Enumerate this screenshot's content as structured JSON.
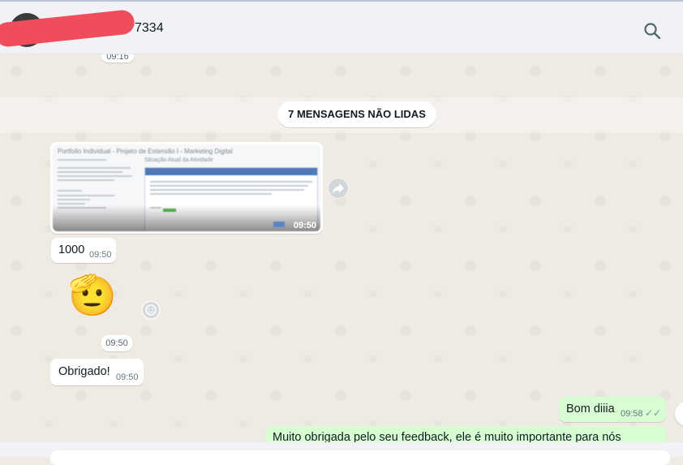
{
  "header": {
    "contact_name_suffix": "7334"
  },
  "messages": {
    "top_time": "09:16",
    "unread_divider": "7 MENSAGENS NÃO LIDAS",
    "image": {
      "title_text": "Portfolio Individual - Projeto de Extensão I - Marketing Digital",
      "panel_heading": "Situação Atual da Atividade",
      "time": "09:50"
    },
    "text_1000": {
      "text": "1000",
      "time": "09:50"
    },
    "emoji": {
      "glyph": "🫡",
      "time": "09:50"
    },
    "obrigado": {
      "text": "Obrigado!",
      "time": "09:50"
    },
    "bom_dia": {
      "text": "Bom diiia",
      "time": "09:58",
      "status": "✓✓"
    },
    "feedback": {
      "text": "Muito obrigada pelo seu feedback, ele é muito importante para nós"
    }
  },
  "icons": {
    "search": "search-icon",
    "forward": "forward-icon",
    "reaction": "emoji-reaction-icon",
    "read_receipt": "double-check-icon"
  },
  "colors": {
    "chat_bg": "#efeae2",
    "outgoing_bubble": "#d9fdd3",
    "incoming_bubble": "#ffffff",
    "redaction": "#ef4c5c",
    "read_tick": "#8696a0"
  }
}
